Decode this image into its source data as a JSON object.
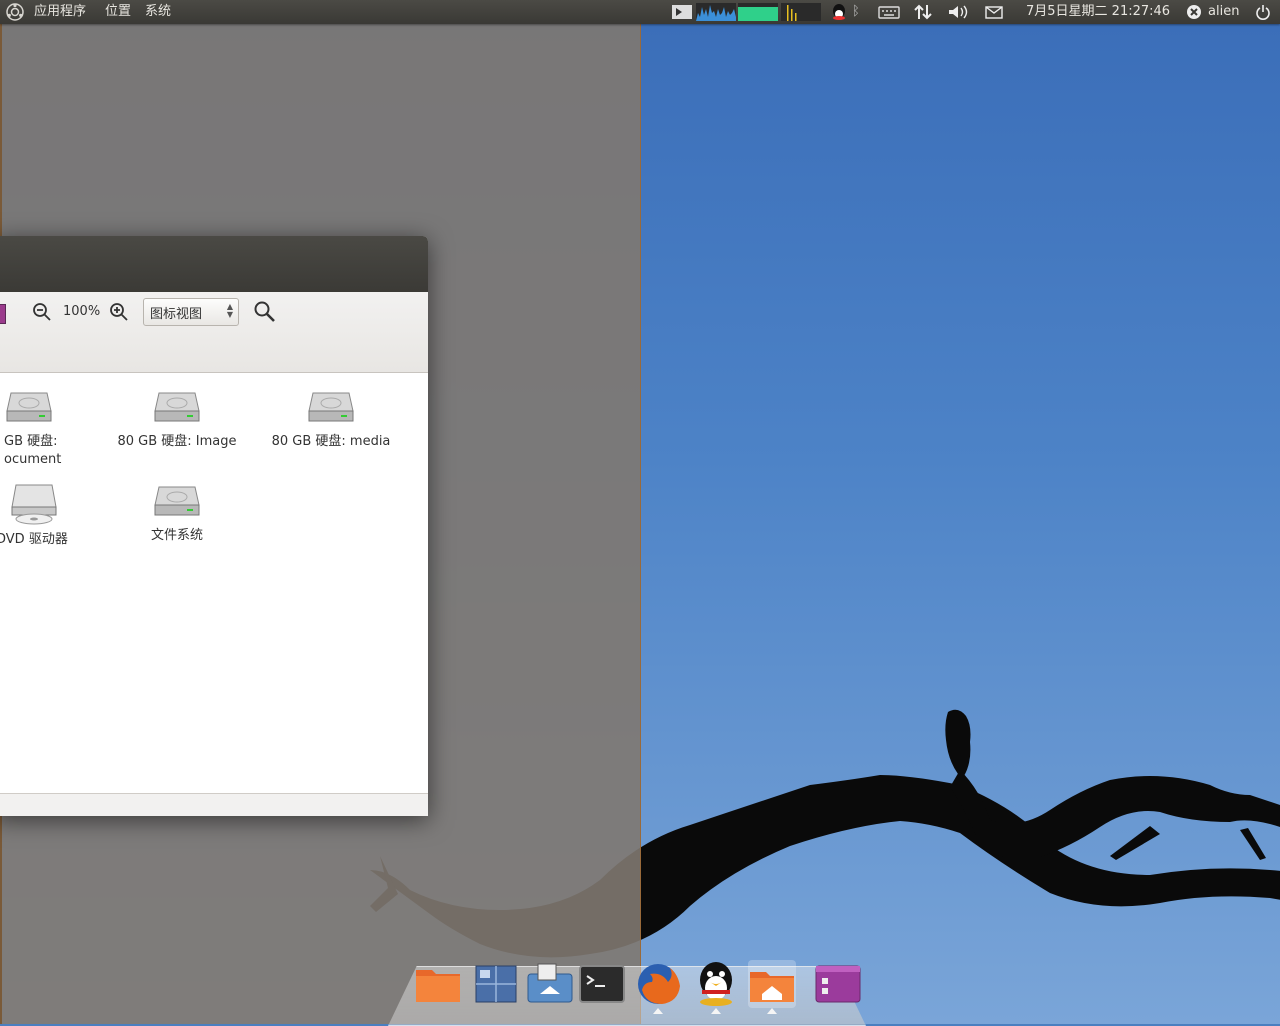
{
  "top_panel": {
    "menus": {
      "applications": "应用程序",
      "places": "位置",
      "system": "系统"
    },
    "clock": "7月5日星期二 21:27:46",
    "user": "alien",
    "tray_icons": [
      "screenlet-icon",
      "cpu-graph-icon",
      "memory-graph-icon",
      "load-graph-icon",
      "qq-tray-icon",
      "bluetooth-icon",
      "keyboard-icon",
      "network-icon",
      "volume-icon",
      "mail-icon",
      "user-status-icon",
      "power-icon"
    ]
  },
  "file_manager": {
    "toolbar": {
      "zoom_level": "100%",
      "view_mode": "图标视图"
    },
    "drives": [
      {
        "label_line1": "GB 硬盘:",
        "label_line2": "ocument",
        "type": "hdd"
      },
      {
        "label_line1": "80 GB 硬盘: Image",
        "label_line2": "",
        "type": "hdd"
      },
      {
        "label_line1": "80 GB 硬盘: media",
        "label_line2": "",
        "type": "hdd"
      },
      {
        "label_line1": "DVD 驱动器",
        "label_line2": "",
        "type": "dvd"
      },
      {
        "label_line1": "文件系统",
        "label_line2": "",
        "type": "hdd"
      }
    ]
  },
  "dock": {
    "items": [
      "folder-icon",
      "workspace-switcher-icon",
      "desktop-icon",
      "terminal-icon",
      "firefox-icon",
      "qq-icon",
      "home-folder-icon",
      "purple-app-icon"
    ]
  },
  "colors": {
    "panel": "#3b3a36",
    "sky": "#4d83c7",
    "overlay": "#807870"
  }
}
